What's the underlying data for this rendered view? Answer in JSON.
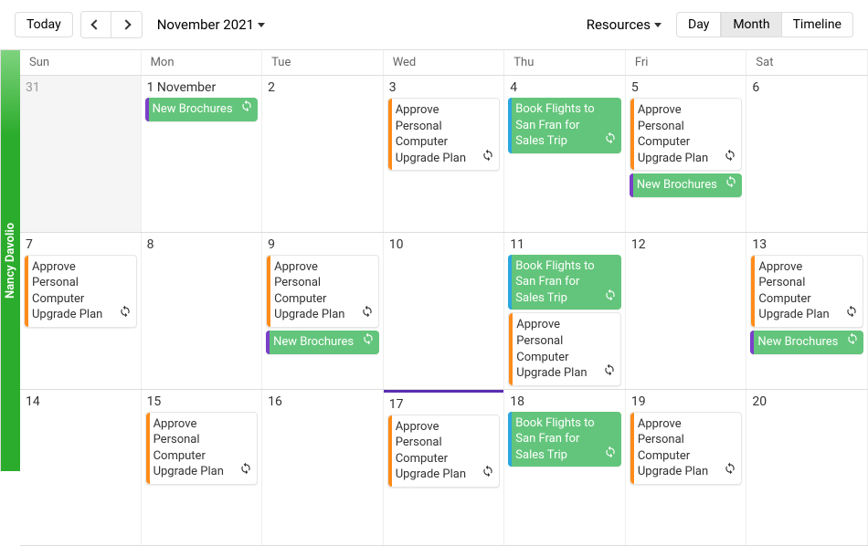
{
  "toolbar": {
    "today": "Today",
    "title": "November 2021",
    "resources": "Resources",
    "views": {
      "day": "Day",
      "month": "Month",
      "timeline": "Timeline"
    }
  },
  "dayhead": [
    "Sun",
    "Mon",
    "Tue",
    "Wed",
    "Thu",
    "Fri",
    "Sat"
  ],
  "resource": "Nancy Davolio",
  "events": {
    "brochures": "New Brochures",
    "approve": "Approve Personal Computer Upgrade Plan",
    "flights": "Book Flights to San Fran for Sales Trip"
  },
  "cells": {
    "r0c0": "31",
    "r0c1": "1 November",
    "r0c2": "2",
    "r0c3": "3",
    "r0c4": "4",
    "r0c5": "5",
    "r0c6": "6",
    "r1c0": "7",
    "r1c1": "8",
    "r1c2": "9",
    "r1c3": "10",
    "r1c4": "11",
    "r1c5": "12",
    "r1c6": "13",
    "r2c0": "14",
    "r2c1": "15",
    "r2c2": "16",
    "r2c3": "17",
    "r2c4": "18",
    "r2c5": "19",
    "r2c6": "20"
  }
}
